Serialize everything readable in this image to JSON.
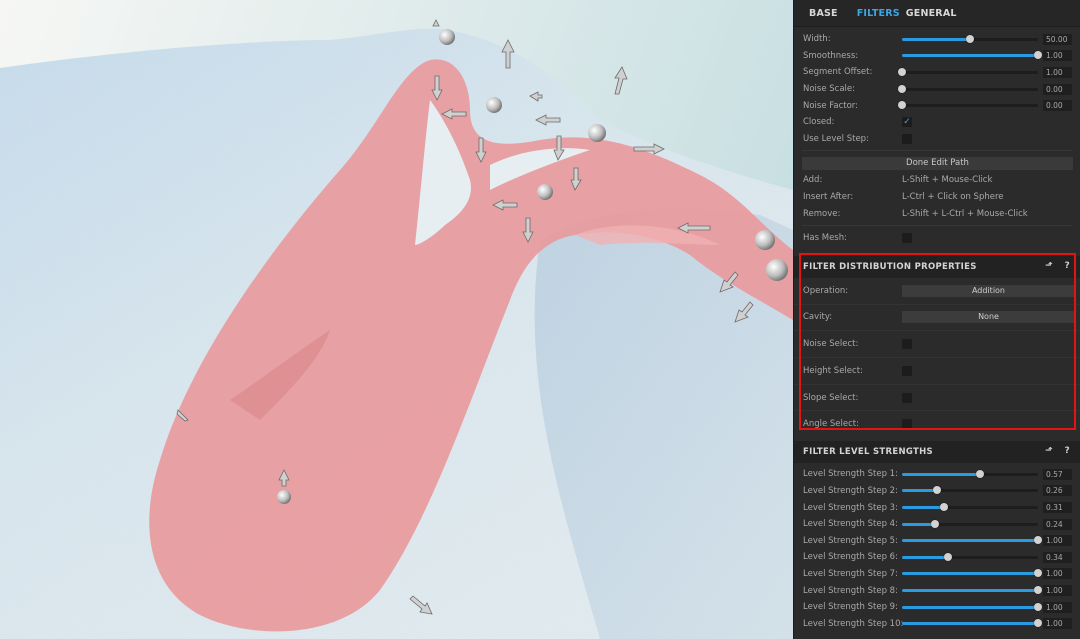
{
  "tabs": [
    {
      "label": "BASE",
      "active": false
    },
    {
      "label": "FILTERS",
      "active": true
    },
    {
      "label": "GENERAL",
      "active": false
    }
  ],
  "path_settings": [
    {
      "label": "Width:",
      "value": 0.5,
      "display": "50.00"
    },
    {
      "label": "Smoothness:",
      "value": 1.0,
      "display": "1.00"
    },
    {
      "label": "Segment Offset:",
      "value": 0.0,
      "display": "1.00"
    },
    {
      "label": "Noise Scale:",
      "value": 0.0,
      "display": "0.00"
    },
    {
      "label": "Noise Factor:",
      "value": 0.0,
      "display": "0.00"
    }
  ],
  "closed": {
    "label": "Closed:",
    "checked": true
  },
  "use_level_step": {
    "label": "Use Level Step:",
    "checked": false
  },
  "edit_path": {
    "button_label": "Done Edit Path",
    "hints": [
      {
        "label": "Add:",
        "value": "L-Shift + Mouse-Click"
      },
      {
        "label": "Insert After:",
        "value": "L-Ctrl + Click on Sphere"
      },
      {
        "label": "Remove:",
        "value": "L-Shift + L-Ctrl + Mouse-Click"
      }
    ]
  },
  "has_mesh": {
    "label": "Has Mesh:",
    "checked": false
  },
  "distribution": {
    "title": "FILTER DISTRIBUTION PROPERTIES",
    "back_icon": "back-arrow-icon",
    "help_icon": "help-icon",
    "back_glyph": "⬏",
    "help_glyph": "?",
    "operation": {
      "label": "Operation:",
      "value": "Addition"
    },
    "cavity": {
      "label": "Cavity:",
      "value": "None"
    },
    "checks": [
      {
        "label": "Noise Select:",
        "checked": false
      },
      {
        "label": "Height Select:",
        "checked": false
      },
      {
        "label": "Slope Select:",
        "checked": false
      },
      {
        "label": "Angle Select:",
        "checked": false
      }
    ]
  },
  "level_strengths": {
    "title": "FILTER LEVEL STRENGTHS",
    "back_glyph": "⬏",
    "help_glyph": "?",
    "steps": [
      {
        "label": "Level Strength Step 1:",
        "value": 0.57,
        "display": "0.57"
      },
      {
        "label": "Level Strength Step 2:",
        "value": 0.26,
        "display": "0.26"
      },
      {
        "label": "Level Strength Step 3:",
        "value": 0.31,
        "display": "0.31"
      },
      {
        "label": "Level Strength Step 4:",
        "value": 0.24,
        "display": "0.24"
      },
      {
        "label": "Level Strength Step 5:",
        "value": 1.0,
        "display": "1.00"
      },
      {
        "label": "Level Strength Step 6:",
        "value": 0.34,
        "display": "0.34"
      },
      {
        "label": "Level Strength Step 7:",
        "value": 1.0,
        "display": "1.00"
      },
      {
        "label": "Level Strength Step 8:",
        "value": 1.0,
        "display": "1.00"
      },
      {
        "label": "Level Strength Step 9:",
        "value": 1.0,
        "display": "1.00"
      },
      {
        "label": "Level Strength Step 10:",
        "value": 1.0,
        "display": "1.00"
      }
    ]
  },
  "colors": {
    "accent": "#2b9be0",
    "path_pink": "#e89a9c",
    "highlight_box": "#e31414",
    "panel_bg": "#2b2b2b"
  }
}
